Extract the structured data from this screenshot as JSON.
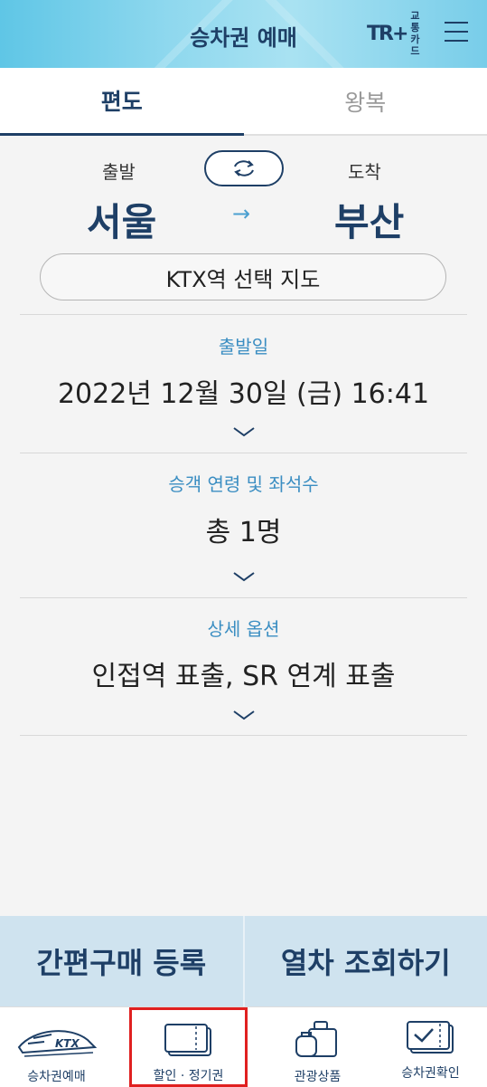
{
  "header": {
    "title": "승차권 예매",
    "card_logo": "TR+",
    "card_line1": "교통",
    "card_line2": "카드",
    "menu_icon": "hamburger-menu-icon"
  },
  "tabs": [
    {
      "label": "편도",
      "active": true
    },
    {
      "label": "왕복",
      "active": false
    }
  ],
  "route": {
    "departure_label": "출발",
    "arrival_label": "도착",
    "departure": "서울",
    "arrival": "부산",
    "arrow": "→",
    "swap_icon": "swap-icon"
  },
  "map_button": "KTX역 선택 지도",
  "sections": [
    {
      "label": "출발일",
      "value": "2022년 12월 30일 (금) 16:41"
    },
    {
      "label": "승객 연령 및 좌석수",
      "value": "총 1명"
    },
    {
      "label": "상세 옵션",
      "value": "인접역 표출, SR 연계 표출"
    }
  ],
  "actions": {
    "quick_purchase": "간편구매 등록",
    "search_trains": "열차 조회하기"
  },
  "bottom_nav": [
    {
      "label": "승차권예매",
      "icon": "ktx-train-icon"
    },
    {
      "label": "할인 · 정기권",
      "icon": "ticket-icon",
      "highlighted": true
    },
    {
      "label": "관광상품",
      "icon": "luggage-icon"
    },
    {
      "label": "승차권확인",
      "icon": "ticket-check-icon"
    }
  ],
  "colors": {
    "primary": "#1e3f66",
    "accent": "#3b8ec2",
    "highlight": "#e02020"
  }
}
